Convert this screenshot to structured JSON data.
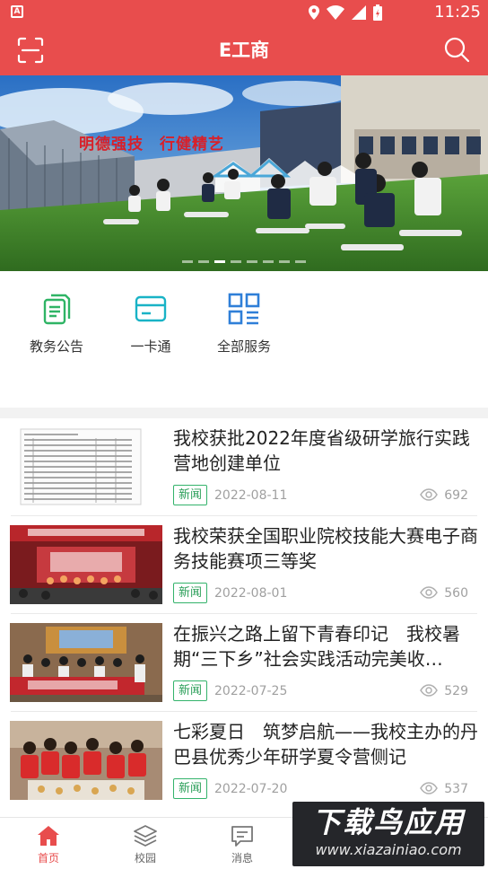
{
  "status_bar": {
    "time": "11:25",
    "app_badge": "A"
  },
  "header": {
    "title": "E工商"
  },
  "banner": {
    "slogan": "明德强技　行健精艺",
    "slide_count": 8,
    "active_slide": 3
  },
  "services": [
    {
      "label": "教务公告",
      "icon": "document-copy-icon",
      "color": "#2fb465"
    },
    {
      "label": "一卡通",
      "icon": "card-icon",
      "color": "#19b3c6"
    },
    {
      "label": "全部服务",
      "icon": "grid-menu-icon",
      "color": "#2f7fd8"
    }
  ],
  "news": [
    {
      "title": "我校获批2022年度省级研学旅行实践营地创建单位",
      "tag": "新闻",
      "date": "2022-08-11",
      "views": "692"
    },
    {
      "title": "我校荣获全国职业院校技能大赛电子商务技能赛项三等奖",
      "tag": "新闻",
      "date": "2022-08-01",
      "views": "560"
    },
    {
      "title": "在振兴之路上留下青春印记　我校暑期“三下乡”社会实践活动完美收…",
      "tag": "新闻",
      "date": "2022-07-25",
      "views": "529"
    },
    {
      "title": "七彩夏日　筑梦启航——我校主办的丹巴县优秀少年研学夏令营侧记",
      "tag": "新闻",
      "date": "2022-07-20",
      "views": "537"
    }
  ],
  "bottom_nav": [
    {
      "label": "首页",
      "icon": "home-icon",
      "active": true
    },
    {
      "label": "校园",
      "icon": "layers-icon",
      "active": false
    },
    {
      "label": "消息",
      "icon": "message-icon",
      "active": false
    }
  ],
  "watermark": {
    "title": "下载鸟应用",
    "url": "www.xiazainiao.com"
  },
  "colors": {
    "brand": "#e84d4d",
    "tag_green": "#2a9e58",
    "meta_gray": "#a0a0a0"
  }
}
